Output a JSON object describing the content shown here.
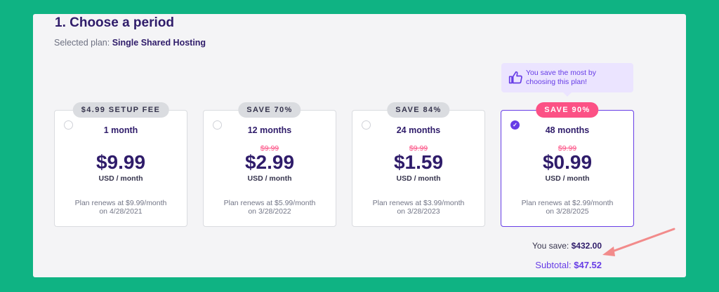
{
  "header": {
    "title": "1. Choose a period",
    "selected_label": "Selected plan:",
    "selected_plan": "Single Shared Hosting"
  },
  "plans": [
    {
      "badge": "$4.99 SETUP FEE",
      "period": "1 month",
      "old_price": "",
      "price": "$9.99",
      "unit": "USD / month",
      "renew_line1": "Plan renews at $9.99/month",
      "renew_line2": "on 4/28/2021",
      "selected": false
    },
    {
      "badge": "SAVE 70%",
      "period": "12 months",
      "old_price": "$9.99",
      "price": "$2.99",
      "unit": "USD / month",
      "renew_line1": "Plan renews at $5.99/month",
      "renew_line2": "on 3/28/2022",
      "selected": false
    },
    {
      "badge": "SAVE 84%",
      "period": "24 months",
      "old_price": "$9.99",
      "price": "$1.59",
      "unit": "USD / month",
      "renew_line1": "Plan renews at $3.99/month",
      "renew_line2": "on 3/28/2023",
      "selected": false
    },
    {
      "badge": "SAVE 90%",
      "period": "48 months",
      "old_price": "$9.99",
      "price": "$0.99",
      "unit": "USD / month",
      "renew_line1": "Plan renews at $2.99/month",
      "renew_line2": "on 3/28/2025",
      "selected": true
    }
  ],
  "tooltip": {
    "text": "You save the most by choosing this plan!",
    "icon": "thumbs-up-icon"
  },
  "summary": {
    "save_label": "You save:",
    "save_value": "$432.00",
    "subtotal_label": "Subtotal:",
    "subtotal_value": "$47.52"
  },
  "colors": {
    "background": "#0fb383",
    "accent": "#673de6",
    "pink": "#fc5185",
    "annotation_arrow": "#f28b8b"
  }
}
